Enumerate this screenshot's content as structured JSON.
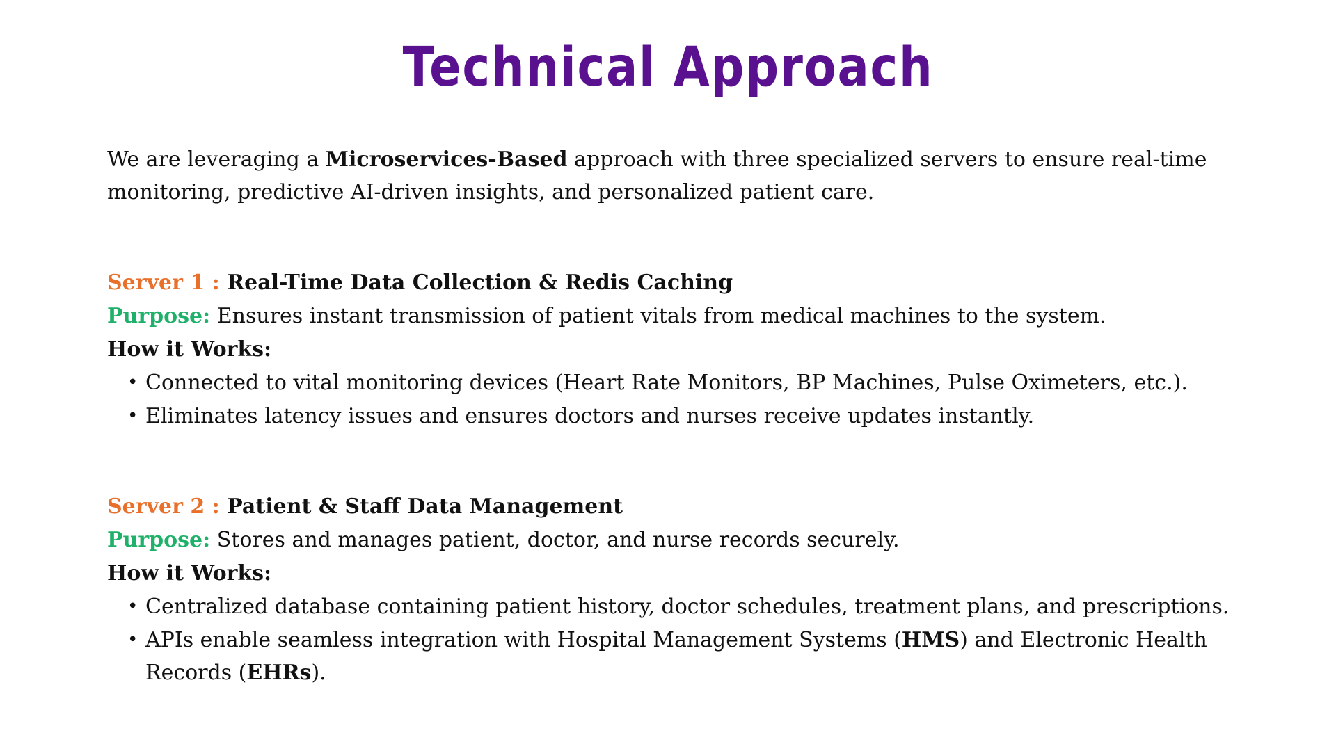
{
  "title": "Technical Approach",
  "intro": {
    "before": "We are leveraging a ",
    "bold": "Microservices-Based",
    "after": " approach with three specialized servers to ensure real-time monitoring, predictive AI-driven insights, and personalized patient care."
  },
  "servers": [
    {
      "label": "Server 1 : ",
      "title": "Real-Time Data Collection & Redis Caching",
      "purpose_label": "Purpose:",
      "purpose_text": " Ensures instant transmission of patient vitals from medical machines to the system.",
      "how_label": "How it Works:",
      "bullets": [
        "Connected to vital monitoring devices (Heart Rate Monitors, BP Machines, Pulse Oximeters, etc.).",
        "Eliminates latency issues and ensures doctors and nurses receive updates instantly."
      ]
    },
    {
      "label": "Server 2 : ",
      "title": "Patient & Staff Data Management",
      "purpose_label": "Purpose:",
      "purpose_text": " Stores and manages patient, doctor, and nurse records securely.",
      "how_label": "How it Works:",
      "bullets": [
        "Centralized database containing patient history, doctor schedules, treatment plans, and prescriptions."
      ],
      "bullet_rich": {
        "t1": "APIs enable seamless integration with Hospital Management Systems (",
        "b1": "HMS",
        "t2": ") and Electronic Health Records (",
        "b2": "EHRs",
        "t3": ")."
      }
    }
  ],
  "bullet_glyph": "•"
}
